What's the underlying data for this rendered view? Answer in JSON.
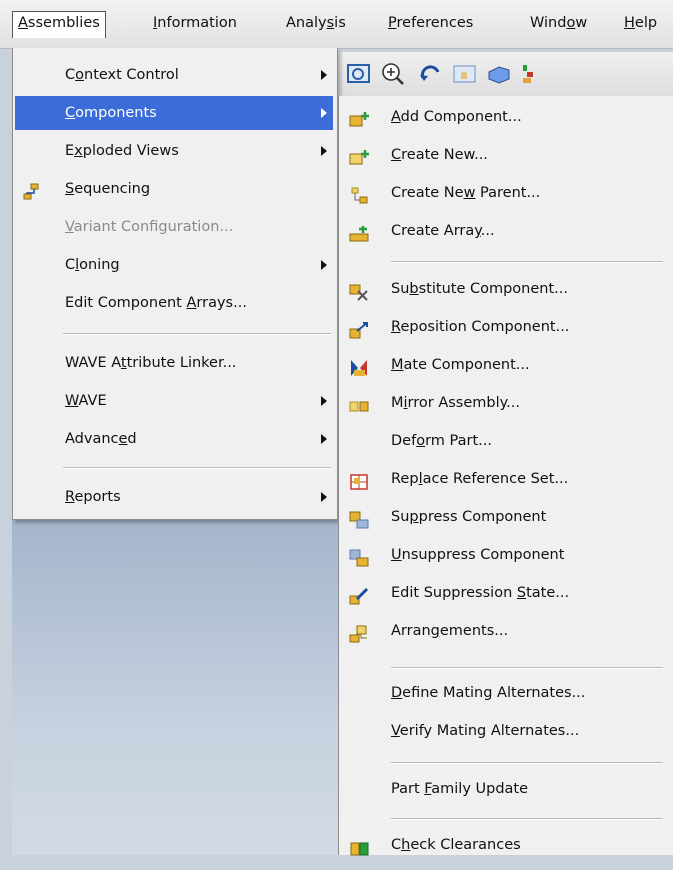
{
  "menubar": {
    "items": [
      {
        "label": "Assemblies",
        "u": 0
      },
      {
        "label": "Information",
        "u": 0
      },
      {
        "label": "Analysis",
        "u": 5
      },
      {
        "label": "Preferences",
        "u": 0
      },
      {
        "label": "Window",
        "u": 4
      },
      {
        "label": "Help",
        "u": 0
      }
    ]
  },
  "assemblies_menu": {
    "items": [
      {
        "label": "Context Control",
        "u": 1,
        "submenu": true
      },
      {
        "label": "Components",
        "u": 0,
        "submenu": true,
        "selected": true
      },
      {
        "label": "Exploded Views",
        "u": 1,
        "submenu": true
      },
      {
        "label": "Sequencing",
        "u": 0,
        "icon": "sequencing-icon"
      },
      {
        "label": "Variant Configuration...",
        "u": 0,
        "disabled": true
      },
      {
        "label": "Cloning",
        "u": 1,
        "submenu": true
      },
      {
        "label": "Edit Component Arrays...",
        "u": 15
      },
      {
        "label": "WAVE Attribute Linker...",
        "u": 6
      },
      {
        "label": "WAVE",
        "u": 0,
        "submenu": true
      },
      {
        "label": "Advanced",
        "u": 6,
        "submenu": true
      },
      {
        "label": "Reports",
        "u": 0,
        "submenu": true
      }
    ]
  },
  "components_submenu": {
    "items": [
      {
        "label": "Add Component...",
        "u": 0,
        "icon": "add-component-icon"
      },
      {
        "label": "Create New...",
        "u": 0,
        "icon": "create-new-icon"
      },
      {
        "label": "Create New Parent...",
        "u": 9,
        "icon": "create-new-parent-icon"
      },
      {
        "label": "Create Array...",
        "u": 11,
        "icon": "create-array-icon"
      },
      {
        "label": "Substitute Component...",
        "u": 2,
        "icon": "substitute-component-icon"
      },
      {
        "label": "Reposition Component...",
        "u": 0,
        "icon": "reposition-component-icon"
      },
      {
        "label": "Mate Component...",
        "u": 0,
        "icon": "mate-component-icon"
      },
      {
        "label": "Mirror Assembly...",
        "u": 1,
        "icon": "mirror-assembly-icon"
      },
      {
        "label": "Deform Part...",
        "u": 3
      },
      {
        "label": "Replace Reference Set...",
        "u": 3,
        "icon": "replace-reference-set-icon"
      },
      {
        "label": "Suppress Component",
        "u": 2,
        "icon": "suppress-component-icon"
      },
      {
        "label": "Unsuppress Component",
        "u": 0,
        "icon": "unsuppress-component-icon"
      },
      {
        "label": "Edit Suppression State...",
        "u": 17,
        "icon": "edit-suppression-state-icon"
      },
      {
        "label": "Arrangements...",
        "u": 5,
        "icon": "arrangements-icon"
      },
      {
        "label": "Define Mating Alternates...",
        "u": 0
      },
      {
        "label": "Verify Mating Alternates...",
        "u": 0
      },
      {
        "label": "Part Family Update",
        "u": 5
      },
      {
        "label": "Check Clearances",
        "u": 1,
        "icon": "check-clearances-icon"
      }
    ]
  }
}
